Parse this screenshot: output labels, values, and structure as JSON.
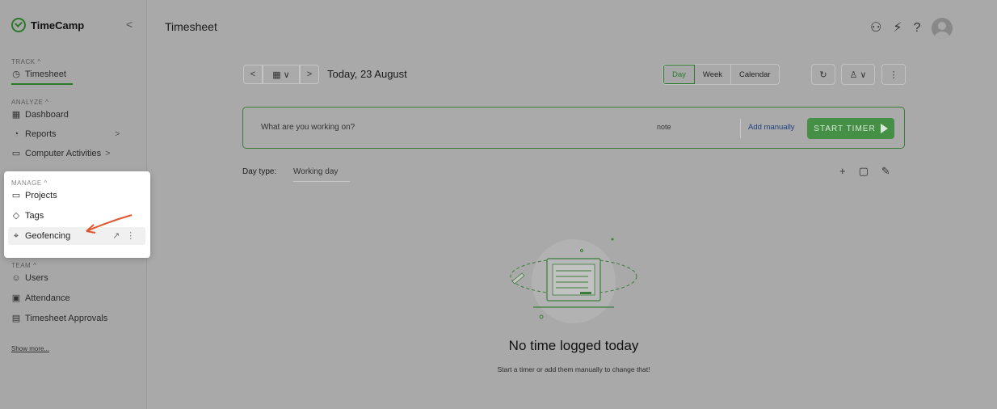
{
  "app": {
    "name": "TimeCamp"
  },
  "sidebar": {
    "collapse_label": "<",
    "track": {
      "title": "TRACK",
      "items": [
        {
          "label": "Timesheet"
        }
      ]
    },
    "analyze": {
      "title": "ANALYZE",
      "items": [
        {
          "label": "Dashboard"
        },
        {
          "label": "Reports"
        },
        {
          "label": "Computer Activities"
        }
      ]
    },
    "manage": {
      "title": "MANAGE",
      "items": [
        {
          "label": "Projects"
        },
        {
          "label": "Tags"
        },
        {
          "label": "Geofencing"
        }
      ]
    },
    "team": {
      "title": "TEAM",
      "items": [
        {
          "label": "Users"
        },
        {
          "label": "Attendance"
        },
        {
          "label": "Timesheet Approvals"
        }
      ]
    },
    "show_more": "Show more..."
  },
  "header": {
    "title": "Timesheet",
    "icons": [
      "add-user-icon",
      "plug-icon",
      "help-icon",
      "avatar"
    ]
  },
  "date_nav": {
    "date_text": "Today, 23 August"
  },
  "views": {
    "tabs": [
      "Day",
      "Week",
      "Calendar"
    ],
    "active": "Day"
  },
  "timer": {
    "placeholder": "What are you working on?",
    "note": "note",
    "add_manually": "Add manually",
    "start_label": "START TIMER"
  },
  "day_type": {
    "label": "Day type:",
    "value": "Working day"
  },
  "empty_state": {
    "title": "No time logged today",
    "subtitle": "Start a timer or add them manually to change that!"
  },
  "colors": {
    "accent": "#2b7a2b",
    "link": "#1f3f7f"
  }
}
